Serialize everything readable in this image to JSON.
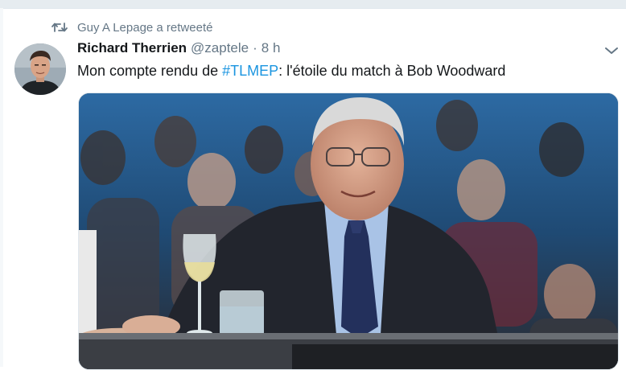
{
  "retweet_context": {
    "icon": "retweet-icon",
    "text": "Guy A Lepage a retweeté"
  },
  "tweet": {
    "author": {
      "name": "Richard Therrien",
      "handle": "@zaptele",
      "avatar": "author-avatar"
    },
    "separator": "·",
    "time": "8 h",
    "menu_icon": "chevron-down-icon",
    "text_before": "Mon compte rendu de ",
    "hashtag": "#TLMEP",
    "text_after": ": l'étoile du match à Bob Woodward",
    "media": {
      "type": "photo",
      "subject": "tweet-photo"
    }
  },
  "colors": {
    "link": "#1b95e0",
    "secondary_text": "#657786",
    "primary_text": "#14171a",
    "divider": "#e6ecf0"
  }
}
